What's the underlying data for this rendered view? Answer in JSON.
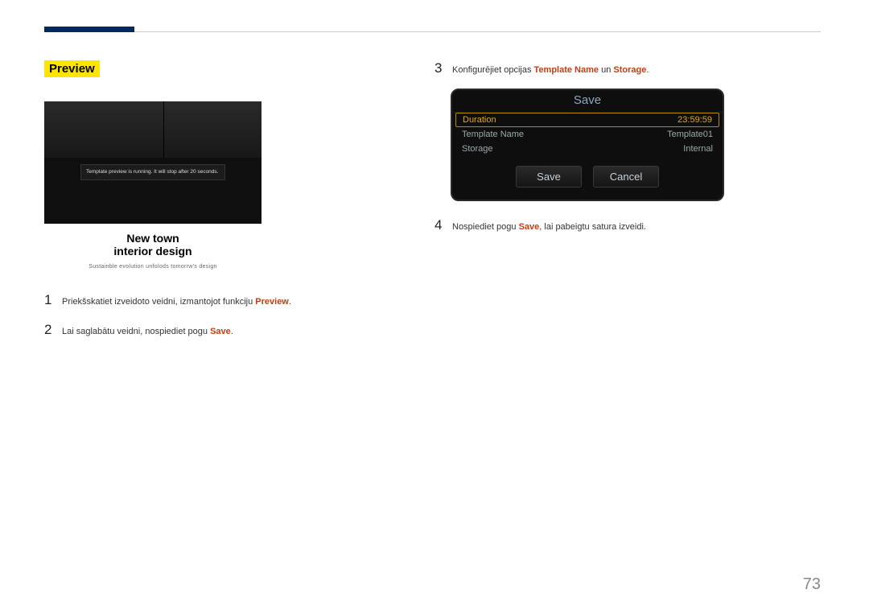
{
  "page_number": "73",
  "left": {
    "section_title": "Preview",
    "preview_badge": "Template preview is running. It will stop after 20 seconds.",
    "caption_line1": "New town",
    "caption_line2": "interior design",
    "caption_tagline": "Sustainble evolution unfolods tomorrw's design",
    "step1_num": "1",
    "step1_pre": "Priekšskatiet izveidoto veidni, izmantojot funkciju ",
    "step1_hl": "Preview",
    "step1_post": ".",
    "step2_num": "2",
    "step2_pre": "Lai saglabātu veidni, nospiediet pogu ",
    "step2_hl": "Save",
    "step2_post": "."
  },
  "right": {
    "step3_num": "3",
    "step3_pre": "Konfigurējiet opcijas ",
    "step3_hl1": "Template Name",
    "step3_mid": " un ",
    "step3_hl2": "Storage",
    "step3_post": ".",
    "dialog": {
      "title": "Save",
      "row1_label": "Duration",
      "row1_value": "23:59:59",
      "row2_label": "Template Name",
      "row2_value": "Template01",
      "row3_label": "Storage",
      "row3_value": "Internal",
      "btn_save": "Save",
      "btn_cancel": "Cancel"
    },
    "step4_num": "4",
    "step4_pre": "Nospiediet pogu ",
    "step4_hl": "Save",
    "step4_post": ", lai pabeigtu satura izveidi."
  }
}
